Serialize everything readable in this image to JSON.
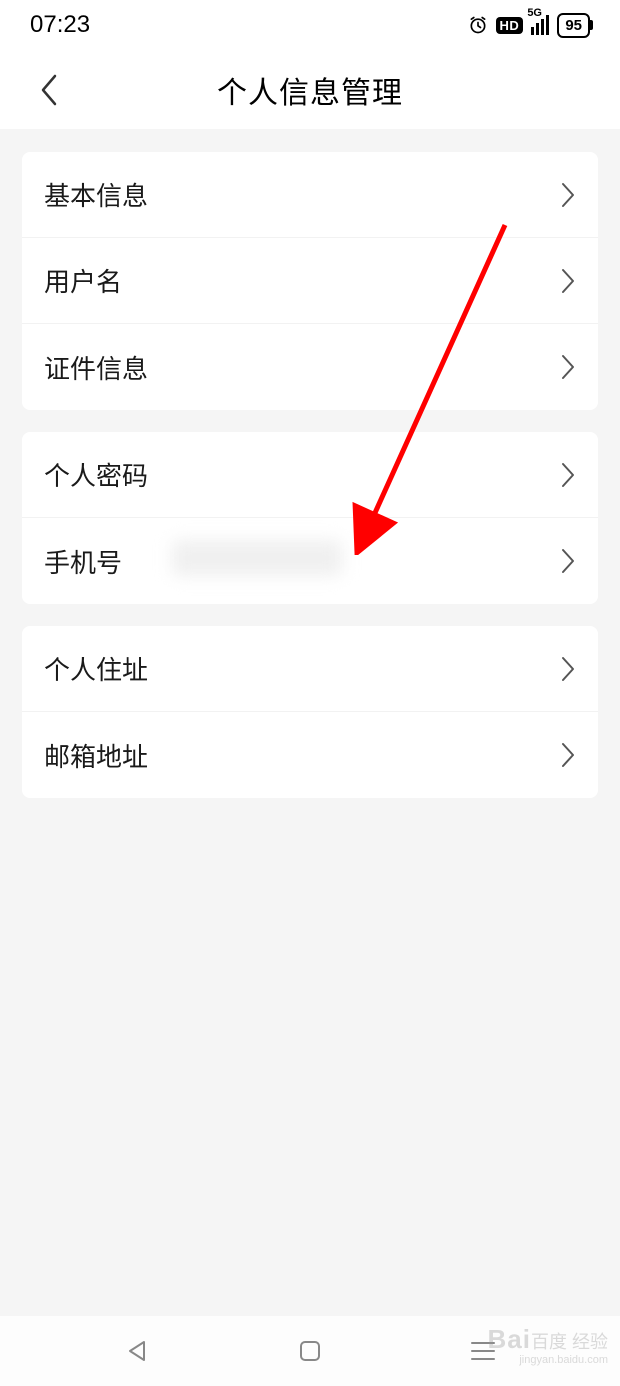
{
  "status": {
    "time": "07:23",
    "network_label": "5G",
    "battery_level": "95",
    "hd_label": "HD"
  },
  "header": {
    "title": "个人信息管理"
  },
  "groups": [
    {
      "rows": [
        {
          "label": "基本信息",
          "value": ""
        },
        {
          "label": "用户名",
          "value": ""
        },
        {
          "label": "证件信息",
          "value": ""
        }
      ]
    },
    {
      "rows": [
        {
          "label": "个人密码",
          "value": ""
        },
        {
          "label": "手机号",
          "value": "",
          "blurred": true
        }
      ]
    },
    {
      "rows": [
        {
          "label": "个人住址",
          "value": ""
        },
        {
          "label": "邮箱地址",
          "value": ""
        }
      ]
    }
  ],
  "annotation": {
    "arrow_color": "#ff0000"
  },
  "watermark": {
    "brand": "Bai",
    "brand2": "百度",
    "suffix": "经验",
    "url": "jingyan.baidu.com"
  }
}
